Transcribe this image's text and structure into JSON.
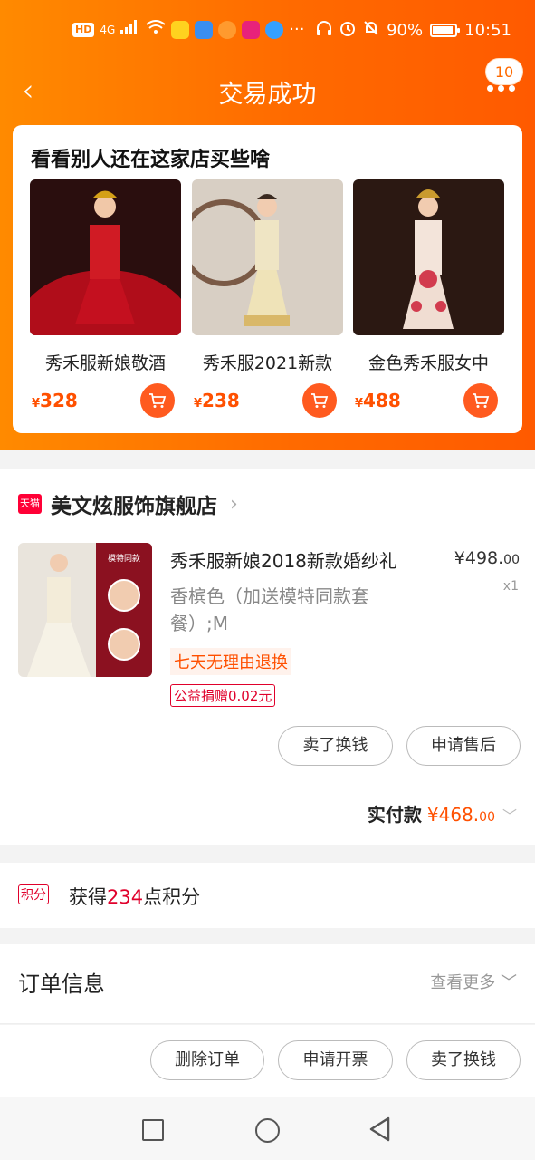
{
  "status_bar": {
    "left_badge": "HD",
    "network": "4G",
    "battery": "90%",
    "time": "10:51"
  },
  "nav": {
    "back_symbol": "‹",
    "title": "交易成功",
    "message_count": "10"
  },
  "recommend": {
    "title": "看看别人还在这家店买些啥",
    "items": [
      {
        "name": "秀禾服新娘敬酒",
        "currency": "¥",
        "price": "328"
      },
      {
        "name": "秀禾服2021新款",
        "currency": "¥",
        "price": "238"
      },
      {
        "name": "金色秀禾服女中",
        "currency": "¥",
        "price": "488"
      }
    ]
  },
  "order": {
    "tmall_badge": "天猫",
    "shop_name": "美文炫服饰旗舰店",
    "item_title": "秀禾服新娘2018新款婚纱礼",
    "item_sku": "香槟色（加送模特同款套餐）;M",
    "price_currency": "¥",
    "price_int": "498.",
    "price_dec": "00",
    "qty": "x1",
    "tag_return": "七天无理由退换",
    "tag_charity": "公益捐赠0.02元",
    "image_labels": [
      "模特同款"
    ],
    "buttons": {
      "sell": "卖了换钱",
      "aftersale": "申请售后"
    },
    "paid_label": "实付款",
    "paid_currency": "¥",
    "paid_int": "468.",
    "paid_dec": "00"
  },
  "points": {
    "tag": "积分",
    "prefix": "获得",
    "value": "234",
    "suffix": "点积分"
  },
  "order_info": {
    "title": "订单信息",
    "more": "查看更多"
  },
  "bottom_actions": {
    "delete": "删除订单",
    "invoice": "申请开票",
    "sell": "卖了换钱"
  },
  "colors": {
    "header_orange": "#ff6a00",
    "price_orange": "#ff5000",
    "tmall_red": "#ff0036"
  }
}
